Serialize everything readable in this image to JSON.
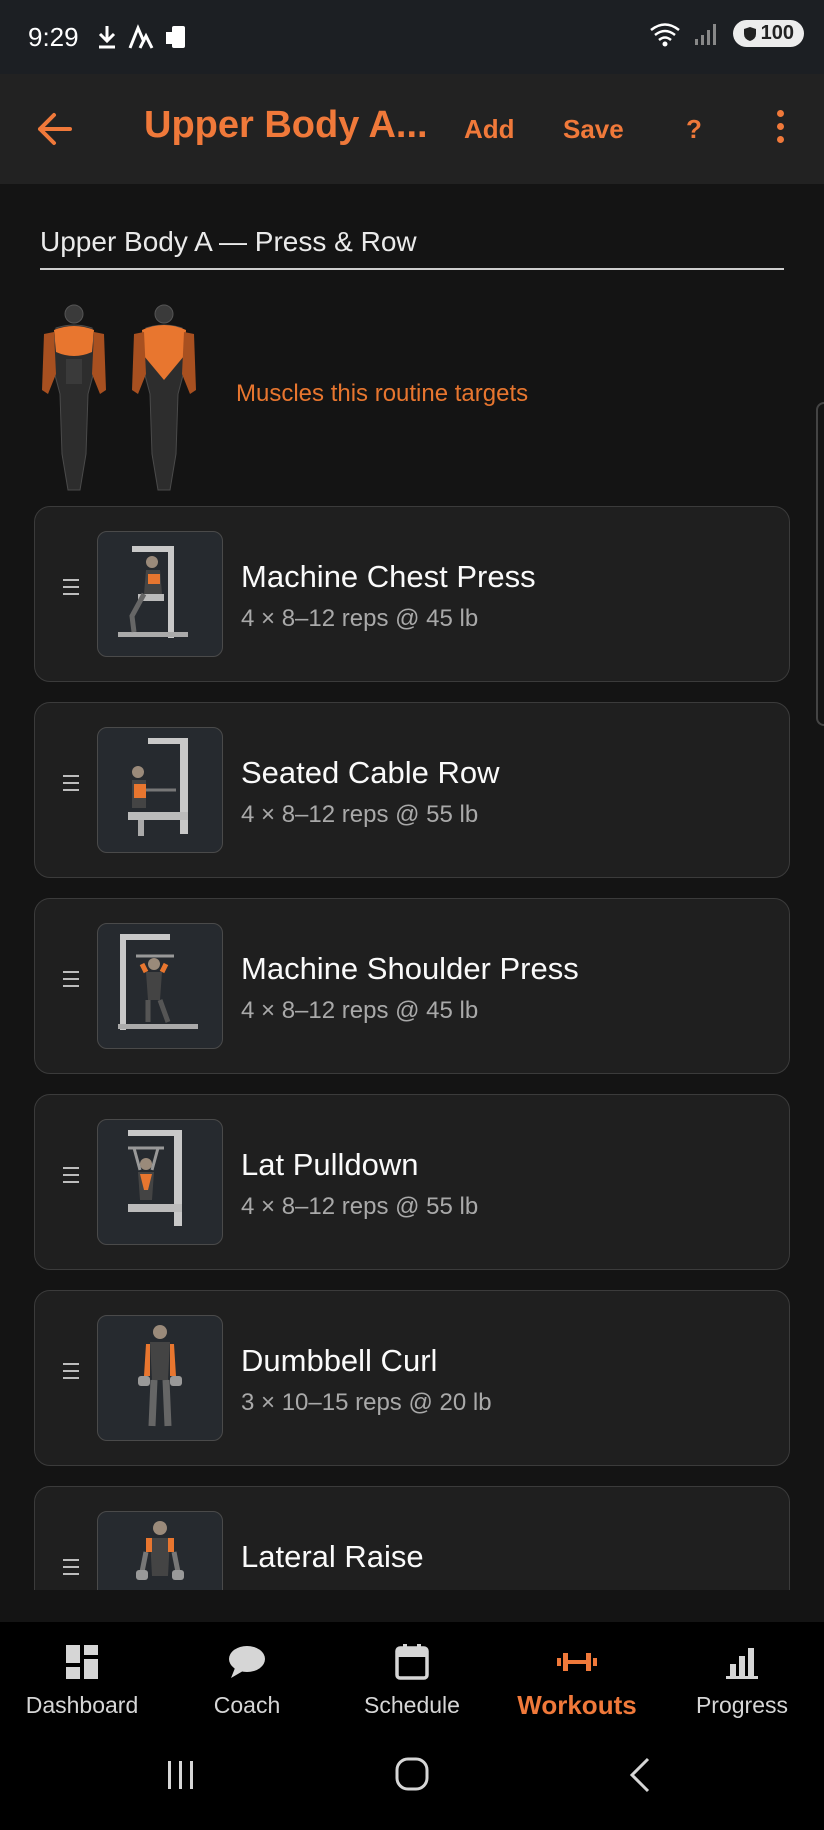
{
  "status_bar": {
    "time": "9:29",
    "battery": "100"
  },
  "appbar": {
    "title": "Upper Body A...",
    "add_label": "Add",
    "save_label": "Save",
    "help_label": "?"
  },
  "routine": {
    "name": "Upper Body A — Press & Row",
    "muscles_label": "Muscles this routine targets"
  },
  "exercises": [
    {
      "name": "Machine Chest Press",
      "detail": "4 × 8–12 reps @ 45 lb",
      "icon": "chest-press-machine"
    },
    {
      "name": "Seated Cable Row",
      "detail": "4 × 8–12 reps @ 55 lb",
      "icon": "cable-row-machine"
    },
    {
      "name": "Machine Shoulder Press",
      "detail": "4 × 8–12 reps @ 45 lb",
      "icon": "shoulder-press-machine"
    },
    {
      "name": "Lat Pulldown",
      "detail": "4 × 8–12 reps @ 55 lb",
      "icon": "lat-pulldown-machine"
    },
    {
      "name": "Dumbbell Curl",
      "detail": "3 × 10–15 reps @ 20 lb",
      "icon": "dumbbell-curl"
    },
    {
      "name": "Lateral Raise",
      "detail": "",
      "icon": "lateral-raise"
    }
  ],
  "nav": [
    {
      "label": "Dashboard",
      "icon": "grid-icon",
      "active": false
    },
    {
      "label": "Coach",
      "icon": "chat-icon",
      "active": false
    },
    {
      "label": "Schedule",
      "icon": "calendar-icon",
      "active": false
    },
    {
      "label": "Workouts",
      "icon": "dumbbell-icon",
      "active": true
    },
    {
      "label": "Progress",
      "icon": "bar-chart-icon",
      "active": false
    }
  ],
  "colors": {
    "accent": "#f0793a",
    "background": "#141414",
    "card": "#1f1f1f"
  }
}
